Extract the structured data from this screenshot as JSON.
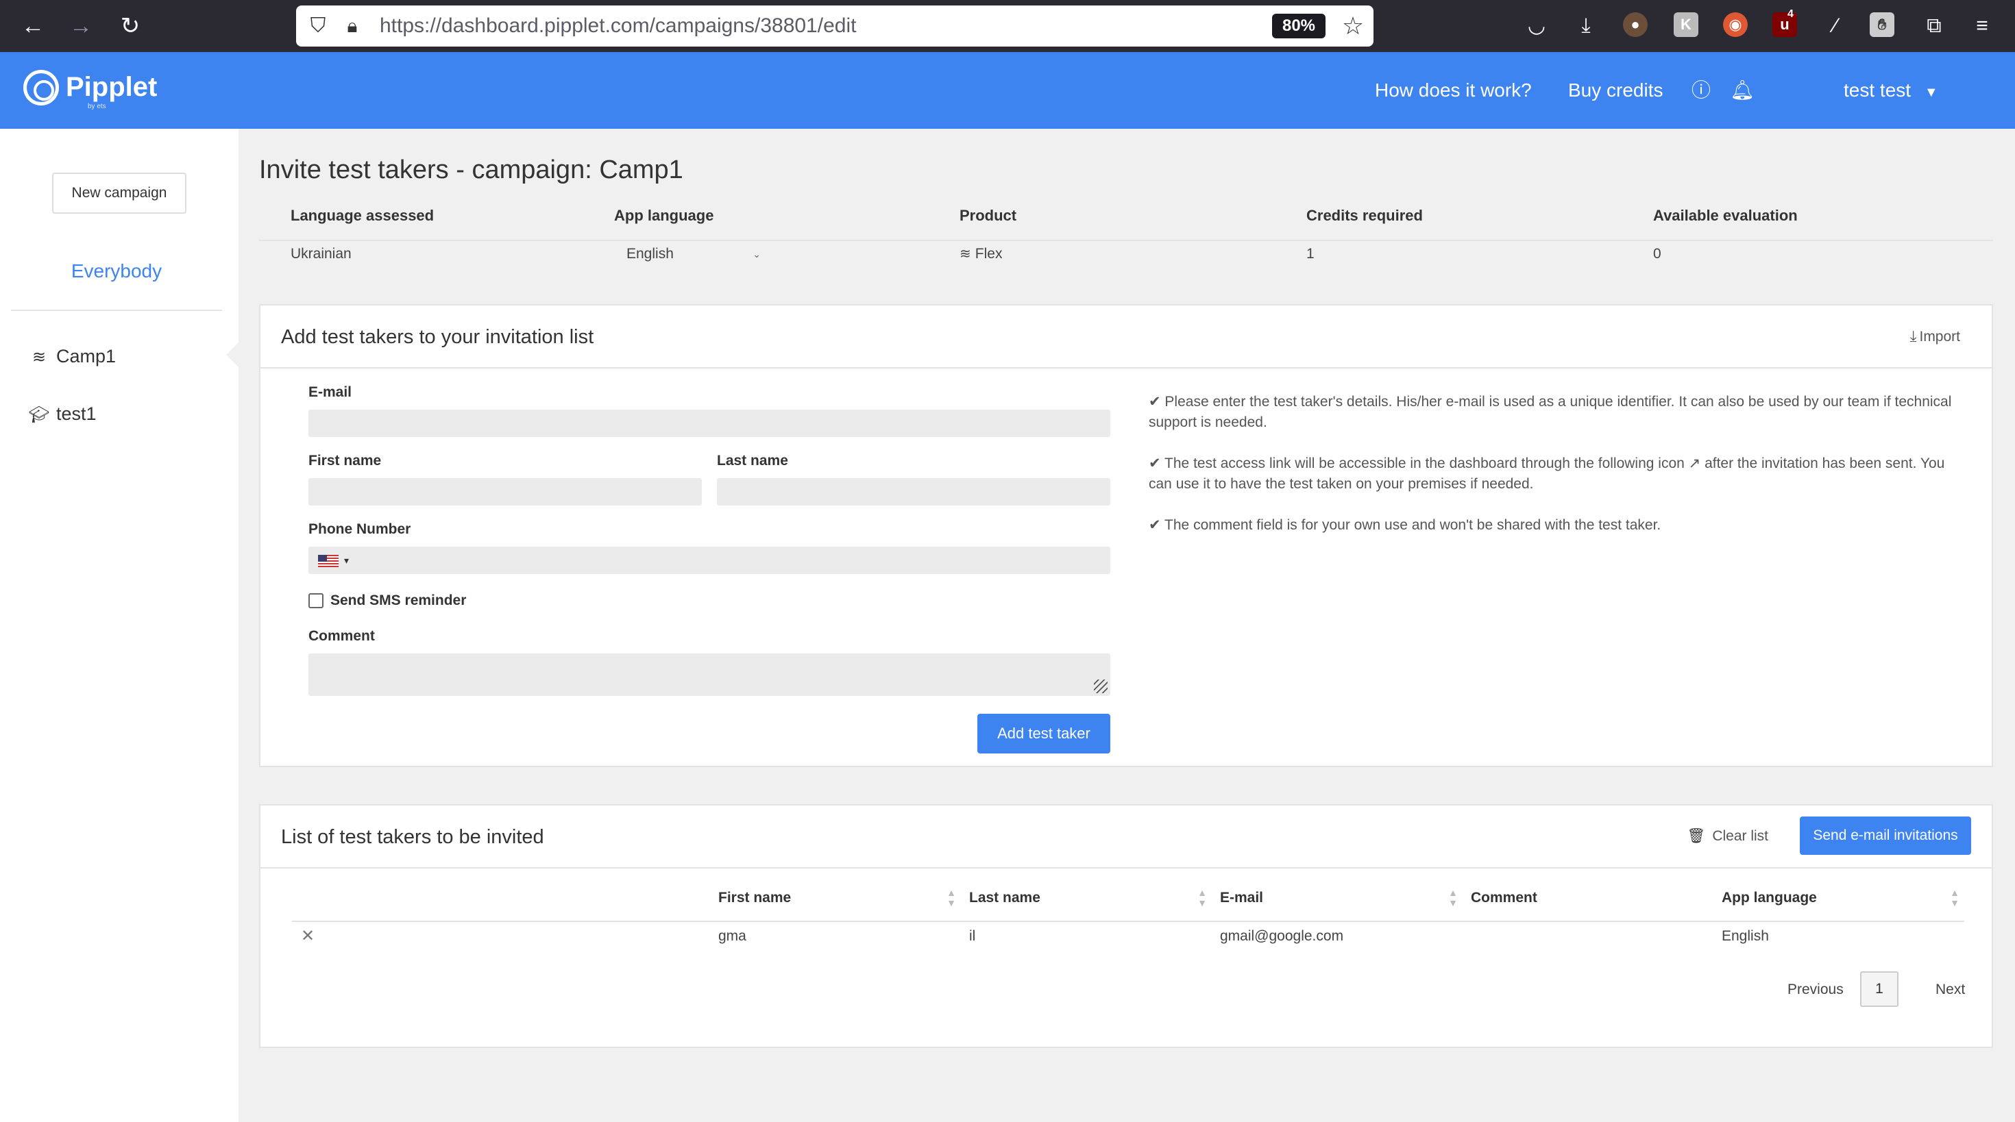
{
  "browser": {
    "url": "https://dashboard.pipplet.com/campaigns/38801/edit",
    "zoom": "80%",
    "ext_badge": "4"
  },
  "header": {
    "logo": "Pipplet",
    "logo_sub": "by ets",
    "how_it_works": "How does it work?",
    "buy_credits": "Buy credits",
    "user": "test test"
  },
  "sidebar": {
    "new_campaign": "New campaign",
    "everybody": "Everybody",
    "items": [
      {
        "label": "Camp1",
        "icon": "layers-icon"
      },
      {
        "label": "test1",
        "icon": "graduation-cap-icon"
      }
    ]
  },
  "page": {
    "title": "Invite test takers - campaign: Camp1",
    "info_headers": [
      "Language assessed",
      "App language",
      "Product",
      "Credits required",
      "Available evaluation"
    ],
    "info_values": {
      "language_assessed": "Ukrainian",
      "app_language": "English",
      "product": "Flex",
      "credits_required": "1",
      "available_evaluation": "0"
    }
  },
  "add_panel": {
    "title": "Add test takers to your invitation list",
    "import": "Import",
    "email_label": "E-mail",
    "first_name_label": "First name",
    "last_name_label": "Last name",
    "phone_label": "Phone Number",
    "sms_label": "Send SMS reminder",
    "comment_label": "Comment",
    "add_button": "Add test taker",
    "help": [
      "✔ Please enter the test taker's details. His/her e-mail is used as a unique identifier. It can also be used by our team if technical support is needed.",
      "✔ The test access link will be accessible in the dashboard through the following icon ↗ after the invitation has been sent. You can use it to have the test taken on your premises if needed.",
      "✔ The comment field is for your own use and won't be shared with the test taker."
    ]
  },
  "list_panel": {
    "title": "List of test takers to be invited",
    "clear_list": "Clear list",
    "send_button": "Send e-mail invitations",
    "columns": [
      "First name",
      "Last name",
      "E-mail",
      "Comment",
      "App language"
    ],
    "rows": [
      {
        "first_name": "gma",
        "last_name": "il",
        "email": "gmail@google.com",
        "comment": "",
        "app_language": "English"
      }
    ],
    "pager": {
      "previous": "Previous",
      "page": "1",
      "next": "Next"
    }
  }
}
